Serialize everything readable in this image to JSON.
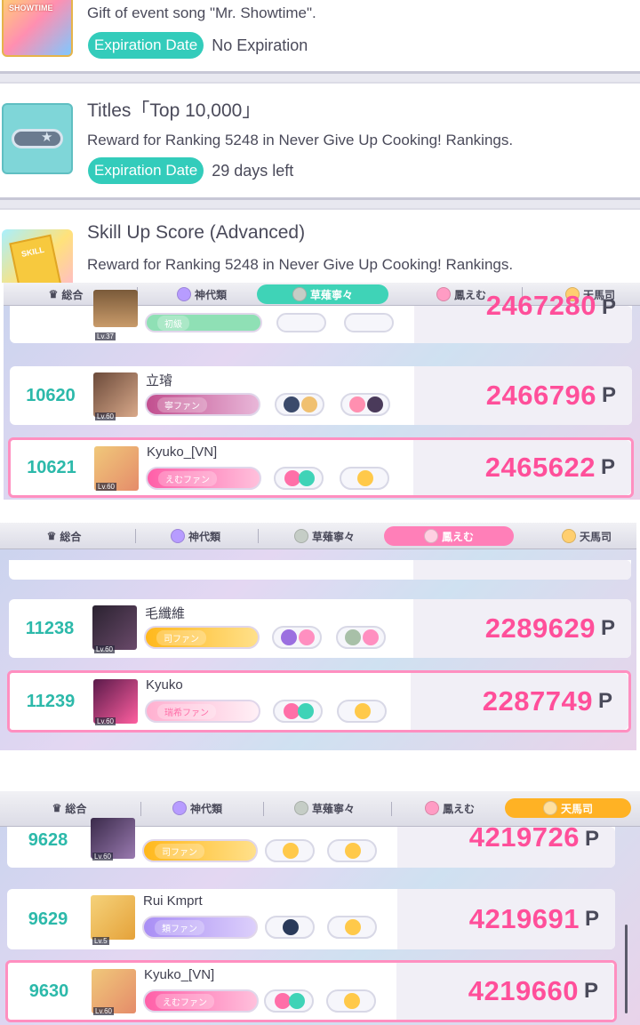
{
  "rewards": [
    {
      "desc": "Gift of event song \"Mr. Showtime\".",
      "expiration_label": "Expiration Date",
      "expiration_value": "No Expiration",
      "thumb_text": "SHOWTIME"
    },
    {
      "title": "Titles「Top 10,000」",
      "desc": "Reward for Ranking 5248 in Never Give Up Cooking! Rankings.",
      "expiration_label": "Expiration Date",
      "expiration_value": "29 days left"
    },
    {
      "title": "Skill Up Score (Advanced)",
      "desc": "Reward for Ranking 5248 in Never Give Up Cooking! Rankings.",
      "thumb_text": "SKILL"
    }
  ],
  "tabs": [
    "総合",
    "神代類",
    "草薙寧々",
    "鳳えむ",
    "天馬司"
  ],
  "panels": [
    {
      "active_tab": "草薙寧々",
      "rows": [
        {
          "rank": "",
          "name": "",
          "level": "Lv.37",
          "badge": "初級",
          "score": "2467280",
          "unit": "P"
        },
        {
          "rank": "10620",
          "name": "立璿",
          "level": "Lv.60",
          "badge": "寧ファン",
          "score": "2466796",
          "unit": "P"
        },
        {
          "rank": "10621",
          "name": "Kyuko_[VN]",
          "level": "Lv.60",
          "badge": "えむファン",
          "score": "2465622",
          "unit": "P"
        }
      ]
    },
    {
      "active_tab": "鳳えむ",
      "rows": [
        {
          "rank": "11238",
          "name": "毛纖維",
          "level": "Lv.60",
          "badge": "司ファン",
          "score": "2289629",
          "unit": "P"
        },
        {
          "rank": "11239",
          "name": "Kyuko",
          "level": "Lv.60",
          "badge": "瑞希ファン",
          "score": "2287749",
          "unit": "P"
        }
      ]
    },
    {
      "active_tab": "天馬司",
      "rows": [
        {
          "rank": "9628",
          "name": "",
          "level": "Lv.60",
          "badge": "司ファン",
          "score": "4219726",
          "unit": "P"
        },
        {
          "rank": "9629",
          "name": "Rui Kmprt",
          "level": "Lv.5",
          "badge": "類ファン",
          "score": "4219691",
          "unit": "P"
        },
        {
          "rank": "9630",
          "name": "Kyuko_[VN]",
          "level": "Lv.60",
          "badge": "えむファン",
          "score": "4219660",
          "unit": "P"
        }
      ]
    }
  ],
  "colors": {
    "teal": "#33ccbb",
    "rank_teal": "#2cb9aa",
    "score_pink": "#ff4f9a",
    "highlight_border": "#ff8fc0",
    "tab_green": "#3fd3b7",
    "tab_pink": "#ff7fb8",
    "tab_orange": "#ffb224"
  }
}
